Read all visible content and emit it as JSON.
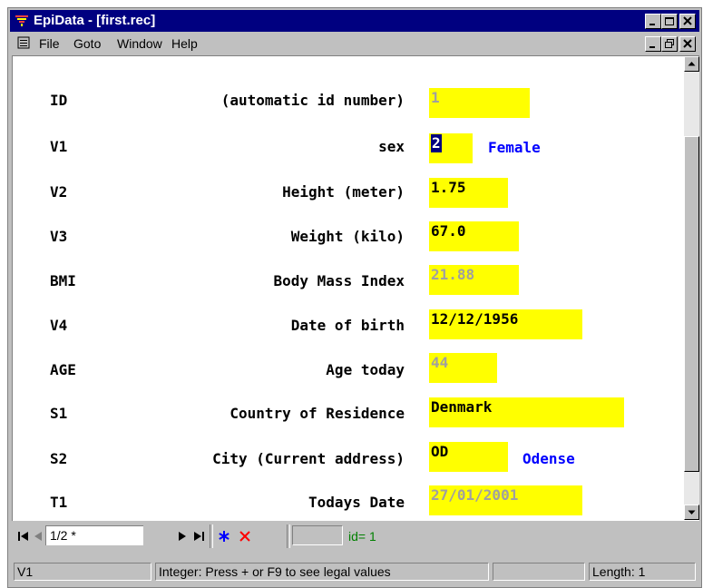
{
  "window": {
    "title": "EpiData - [first.rec]"
  },
  "menu": {
    "items": [
      "File",
      "Goto",
      "Window",
      "Help"
    ]
  },
  "fields": [
    {
      "name": "ID",
      "label": "(automatic id number)",
      "value": "1",
      "readonly": true
    },
    {
      "name": "V1",
      "label": "sex",
      "value": "2",
      "readonly": false,
      "value_label": "Female",
      "selected": true
    },
    {
      "name": "V2",
      "label": "Height (meter)",
      "value": "1.75",
      "readonly": false
    },
    {
      "name": "V3",
      "label": "Weight (kilo)",
      "value": "67.0",
      "readonly": false
    },
    {
      "name": "BMI",
      "label": "Body Mass Index",
      "value": "21.88",
      "readonly": true
    },
    {
      "name": "V4",
      "label": "Date of birth",
      "value": "12/12/1956",
      "readonly": false
    },
    {
      "name": "AGE",
      "label": "Age today",
      "value": "44",
      "readonly": true
    },
    {
      "name": "S1",
      "label": "Country of Residence",
      "value": "Denmark",
      "readonly": false
    },
    {
      "name": "S2",
      "label": "City (Current address)",
      "value": "OD",
      "readonly": false,
      "value_label": "Odense"
    },
    {
      "name": "T1",
      "label": "Todays Date",
      "value": "27/01/2001",
      "readonly": true
    }
  ],
  "navigator": {
    "record": "1/2 *",
    "id_text": "id= 1"
  },
  "status": {
    "field": "V1",
    "message": "Integer:  Press + or F9 to see legal values",
    "extra": "",
    "length": "Length: 1"
  },
  "colors": {
    "title_bar": "#000080",
    "field_bg": "#ffff00",
    "value_label": "#0000ff",
    "readonly_text": "#a0a0a0",
    "id_text": "#008000"
  }
}
